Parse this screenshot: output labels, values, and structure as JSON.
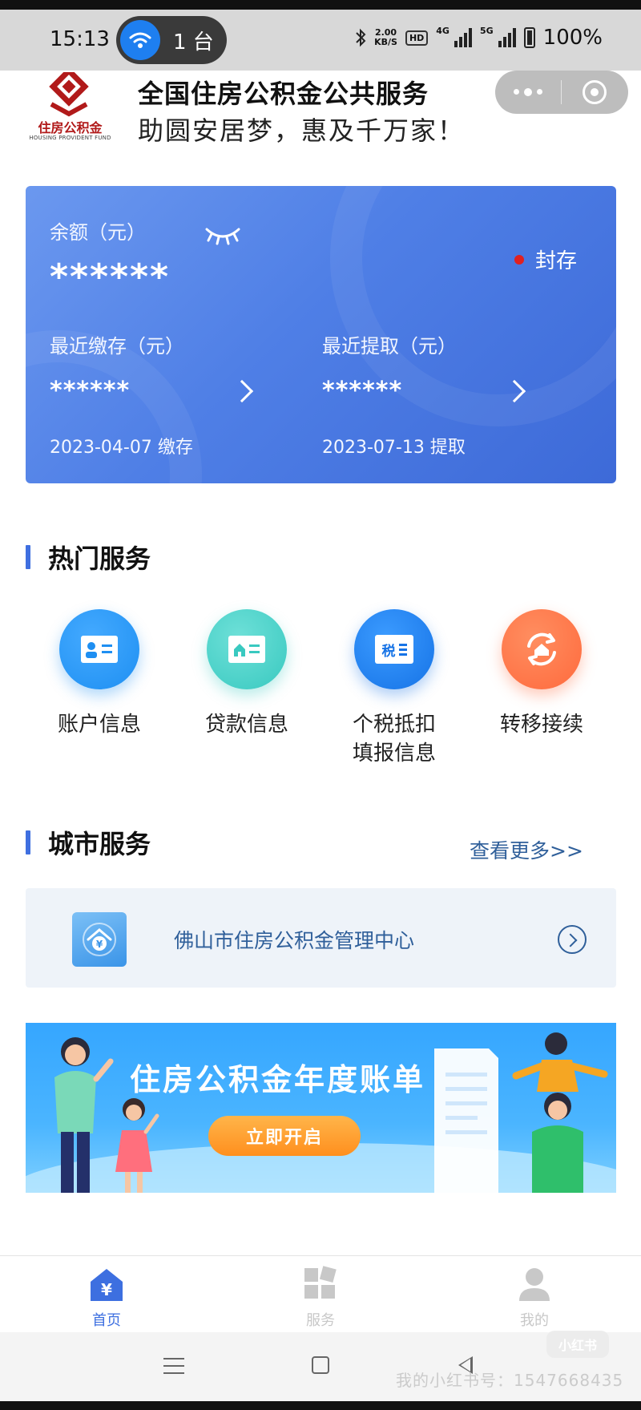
{
  "status_bar": {
    "time": "15:13",
    "pill_label": "1 台",
    "speed_value": "2.00",
    "speed_unit": "KB/S",
    "hd_label": "HD",
    "net1": "4G",
    "net2": "5G",
    "battery": "100%"
  },
  "header": {
    "logo_text": "住房公积金",
    "logo_sub": "HOUSING PROVIDENT FUND",
    "title": "全国住房公积金公共服务",
    "slogan": "助圆安居梦，惠及千万家！"
  },
  "card": {
    "balance_label": "余额（元）",
    "balance_value": "******",
    "status_text": "封存",
    "status_color": "#e02020",
    "deposit_label": "最近缴存（元）",
    "deposit_value": "******",
    "deposit_date": "2023-04-07 缴存",
    "withdraw_label": "最近提取（元）",
    "withdraw_value": "******",
    "withdraw_date": "2023-07-13 提取"
  },
  "hot_services": {
    "title": "热门服务",
    "items": [
      {
        "label": "账户信息",
        "icon": "id-card-icon",
        "color": "#1e8ff2"
      },
      {
        "label": "贷款信息",
        "icon": "house-card-icon",
        "color": "#39c9c0"
      },
      {
        "label_line1": "个税抵扣",
        "label_line2": "填报信息",
        "icon": "tax-icon",
        "icon_text": "税",
        "color": "#1673e6"
      },
      {
        "label": "转移接续",
        "icon": "transfer-house-icon",
        "color": "#ff6a3d"
      }
    ]
  },
  "city_services": {
    "title": "城市服务",
    "more_link": "查看更多>>",
    "item_label": "佛山市住房公积金管理中心"
  },
  "banner": {
    "title": "住房公积金年度账单",
    "button": "立即开启"
  },
  "tabbar": {
    "items": [
      {
        "label": "首页",
        "active": true
      },
      {
        "label": "服务",
        "active": false
      },
      {
        "label": "我的",
        "active": false
      }
    ]
  },
  "watermark": {
    "text": "我的小红书号：1547668435",
    "logo": "小红书"
  }
}
